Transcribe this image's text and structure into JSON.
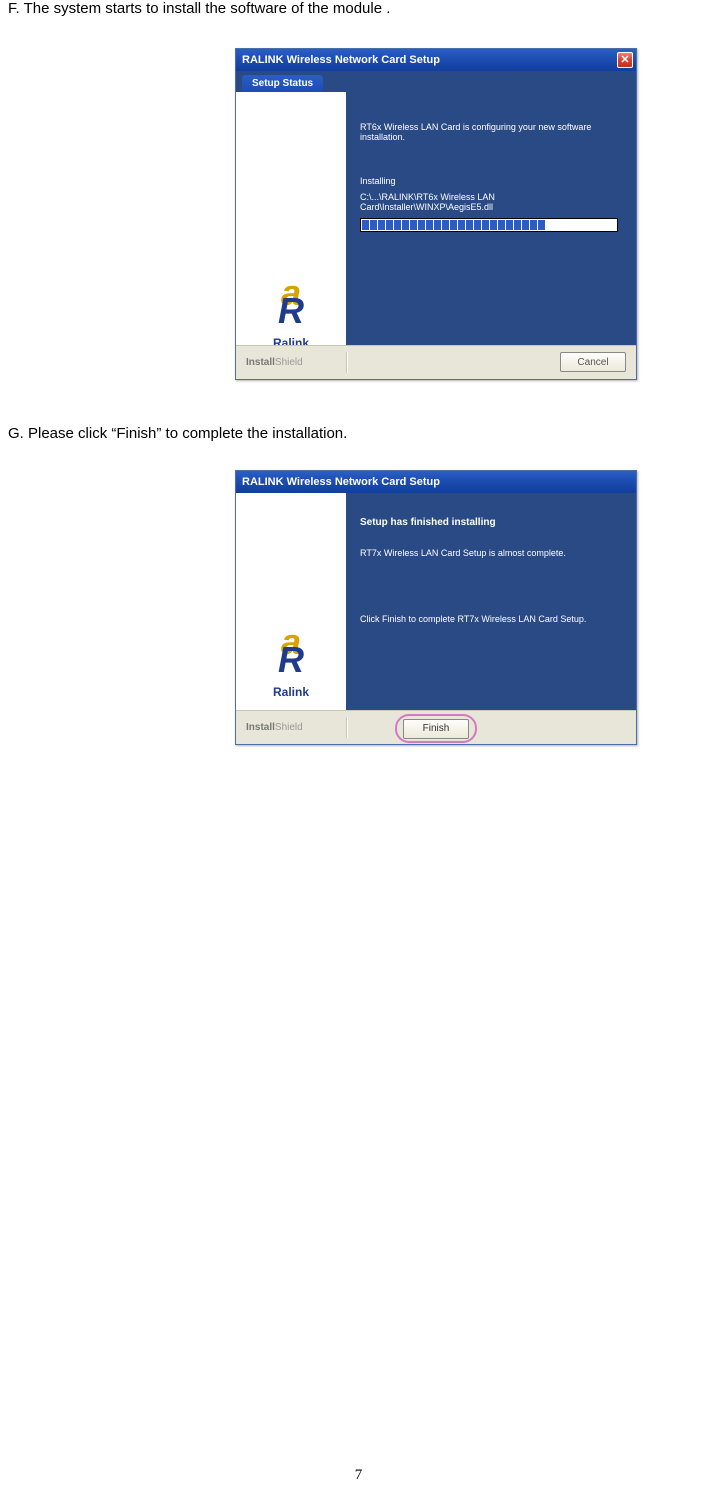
{
  "instructions": {
    "f": "F.    The system starts to install the software of the module .",
    "g": "G.   Please click “Finish” to complete the installation."
  },
  "dialog1": {
    "title": "RALINK Wireless Network Card Setup",
    "tab_label": "Setup Status",
    "line1": "RT6x Wireless LAN Card is configuring your new software installation.",
    "installing_label": "Installing",
    "path": "C:\\...\\RALINK\\RT6x Wireless LAN Card\\Installer\\WINXP\\AegisE5.dll",
    "progress_segments": 23,
    "footer_brand_a": "Install",
    "footer_brand_b": "Shield",
    "cancel_label": "Cancel"
  },
  "dialog2": {
    "title": "RALINK Wireless Network Card Setup",
    "heading": "Setup has finished installing",
    "line1": "RT7x Wireless LAN Card Setup is almost complete.",
    "line2": "Click Finish to complete RT7x Wireless LAN Card Setup.",
    "footer_brand_a": "Install",
    "footer_brand_b": "Shield",
    "finish_label": "Finish"
  },
  "logo": {
    "letter_top": "a",
    "letter_bottom": "R",
    "text": "Ralink"
  },
  "page_number": "7"
}
